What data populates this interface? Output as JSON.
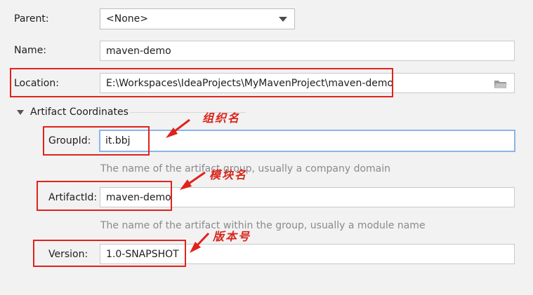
{
  "form": {
    "parent_label": "Parent:",
    "parent_value": "<None>",
    "name_label": "Name:",
    "name_value": "maven-demo",
    "location_label": "Location:",
    "location_value": "E:\\Workspaces\\IdeaProjects\\MyMavenProject\\maven-demo",
    "section_title": "Artifact Coordinates",
    "groupid_label": "GroupId:",
    "groupid_value": "it.bbj",
    "groupid_hint": "The name of the artifact group, usually a company domain",
    "artifactid_label": "ArtifactId:",
    "artifactid_value": "maven-demo",
    "artifactid_hint": "The name of the artifact within the group, usually a module name",
    "version_label": "Version:",
    "version_value": "1.0-SNAPSHOT"
  },
  "annotations": {
    "groupid_note": "组织名",
    "artifactid_note": "模块名",
    "version_note": "版本号"
  },
  "colors": {
    "annotation_red": "#e0221c",
    "focus_blue": "#8cb5e8"
  }
}
